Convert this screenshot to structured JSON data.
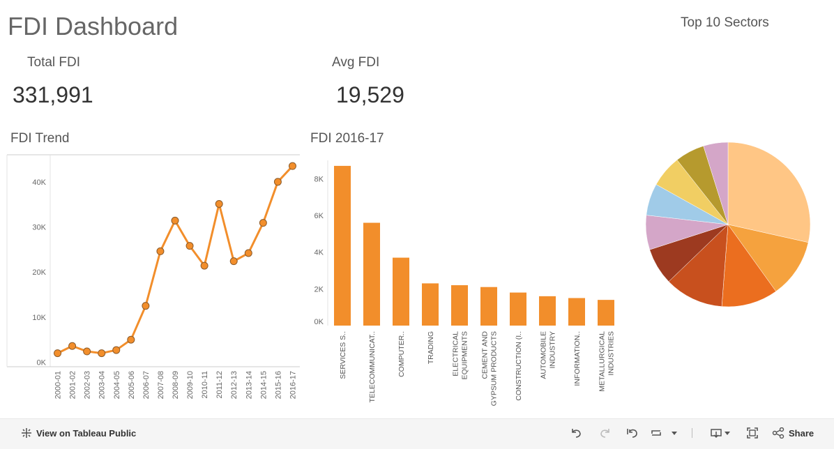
{
  "dashboard": {
    "title": "FDI Dashboard"
  },
  "kpis": [
    {
      "label": "Total FDI",
      "value": "331,991"
    },
    {
      "label": "Avg FDI",
      "value": "19,529"
    }
  ],
  "colors": {
    "line": "#F28E2B",
    "bar": "#F28E2B",
    "marker_stroke": "#8a5a2a",
    "axis": "#ccc",
    "text": "#555"
  },
  "chart_data": [
    {
      "type": "line",
      "title": "FDI Trend",
      "x": [
        "2000-01",
        "2001-02",
        "2002-03",
        "2003-04",
        "2004-05",
        "2005-06",
        "2006-07",
        "2007-08",
        "2008-09",
        "2009-10",
        "2010-11",
        "2011-12",
        "2012-13",
        "2013-14",
        "2014-15",
        "2015-16",
        "2016-17"
      ],
      "values": [
        2000,
        3600,
        2400,
        2000,
        2700,
        5000,
        12500,
        24600,
        31400,
        25800,
        21400,
        35100,
        22400,
        24200,
        30900,
        40000,
        43500
      ],
      "yticks": [
        0,
        10000,
        20000,
        30000,
        40000
      ],
      "ytick_labels": [
        "0K",
        "10K",
        "20K",
        "30K",
        "40K"
      ],
      "ylim": [
        -1000,
        46000
      ]
    },
    {
      "type": "bar",
      "title": "FDI 2016-17",
      "categories": [
        "SERVICES S..",
        "TELECOMMUNICAT..",
        "COMPUTER..",
        "TRADING",
        "ELECTRICAL EQUIPMENTS",
        "CEMENT AND GYPSUM PRODUCTS",
        "CONSTRUCTION (I..",
        "AUTOMOBILE INDUSTRY",
        "INFORMATION..",
        "METALLURGICAL INDUSTRIES"
      ],
      "category_lines": [
        [
          "SERVICES S.."
        ],
        [
          "TELECOMMUNICAT.."
        ],
        [
          "COMPUTER.."
        ],
        [
          "TRADING"
        ],
        [
          "ELECTRICAL",
          "EQUIPMENTS"
        ],
        [
          "CEMENT AND",
          "GYPSUM PRODUCTS"
        ],
        [
          "CONSTRUCTION (I.."
        ],
        [
          "AUTOMOBILE",
          "INDUSTRY"
        ],
        [
          "INFORMATION.."
        ],
        [
          "METALLURGICAL",
          "INDUSTRIES"
        ]
      ],
      "values": [
        8700,
        5600,
        3700,
        2300,
        2200,
        2100,
        1800,
        1600,
        1500,
        1400
      ],
      "yticks": [
        0,
        2000,
        4000,
        6000,
        8000
      ],
      "ytick_labels": [
        "0K",
        "2K",
        "4K",
        "6K",
        "8K"
      ],
      "ylim": [
        0,
        9000
      ]
    },
    {
      "type": "pie",
      "title": "Top 10 Sectors",
      "values": [
        29.5,
        12,
        11.5,
        12,
        7.5,
        7,
        6.5,
        6.5,
        6,
        5
      ],
      "colors": [
        "#FFC685",
        "#F5A23E",
        "#EB6E1F",
        "#C8501E",
        "#9D3A20",
        "#D4A6C8",
        "#A0CBE8",
        "#F1CE63",
        "#B69A2E",
        "#D4A6C8"
      ]
    }
  ],
  "toolbar": {
    "view_label": "View on Tableau Public",
    "share_label": "Share",
    "icons": [
      "tableau-logo-icon",
      "undo-icon",
      "redo-icon",
      "revert-icon",
      "refresh-icon",
      "dropdown-icon",
      "download-icon",
      "fullscreen-icon",
      "share-icon"
    ]
  }
}
